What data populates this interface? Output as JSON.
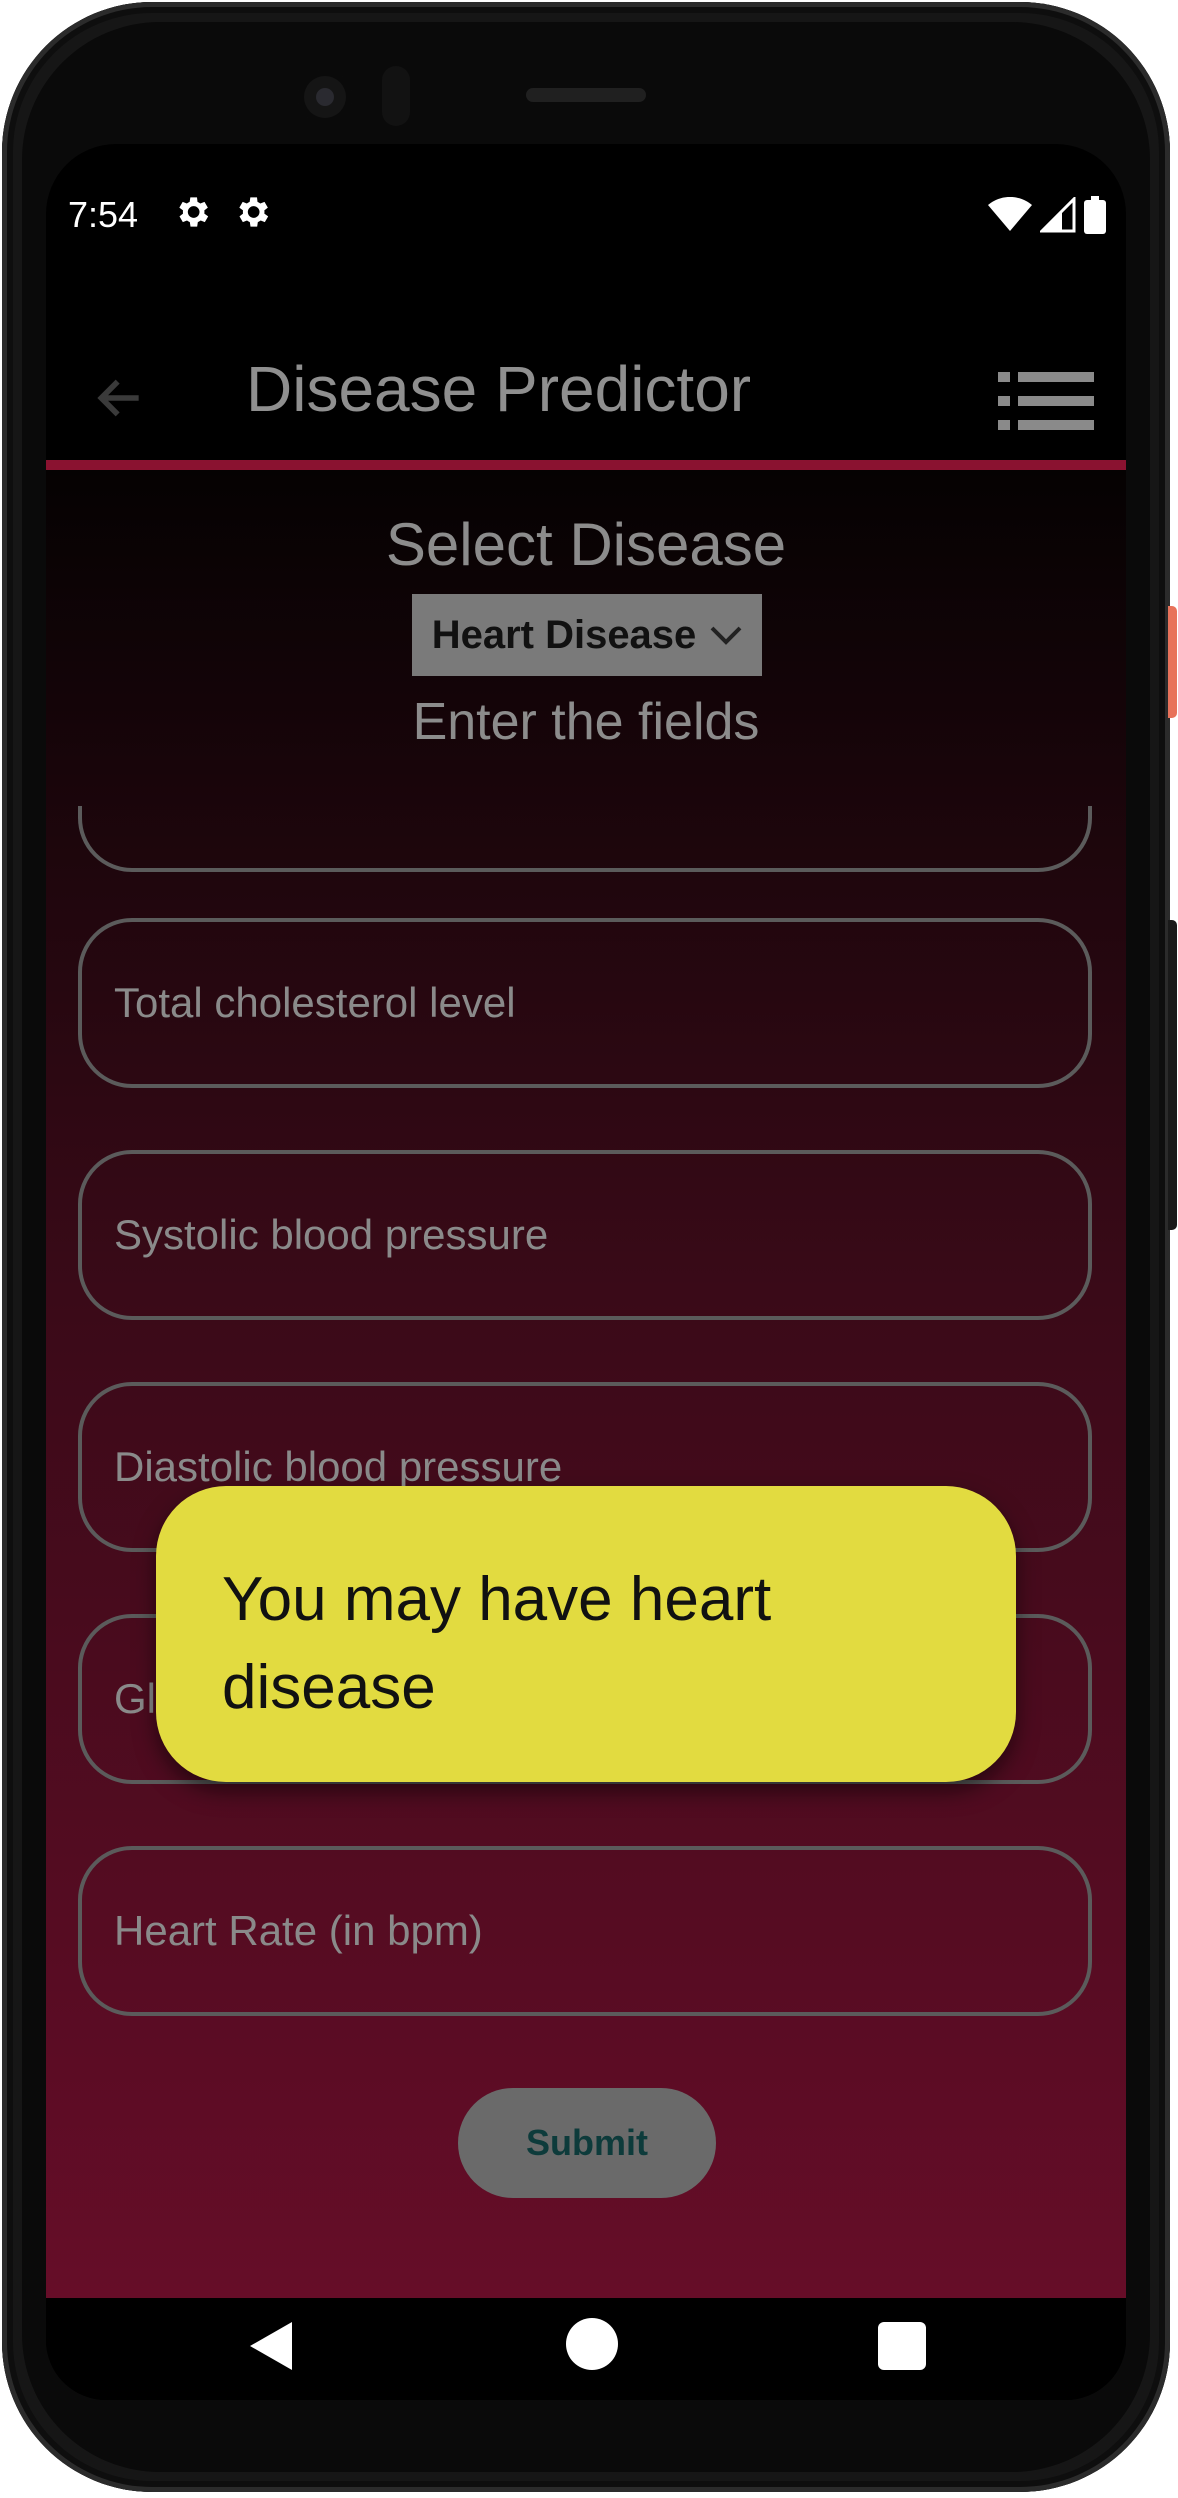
{
  "status_bar": {
    "time": "7:54",
    "left_icons": [
      "gear-icon",
      "gear-icon"
    ],
    "right_icons": [
      "wifi-icon",
      "signal-icon",
      "battery-icon"
    ]
  },
  "app_bar": {
    "title": "Disease Predictor",
    "back_icon": "arrow-left-icon",
    "menu_icon": "list-icon",
    "accent_color": "#8a1230"
  },
  "form": {
    "select_label": "Select Disease",
    "selected_disease": "Heart Disease",
    "instruction": "Enter the fields",
    "fields": [
      {
        "placeholder": "Total cholesterol level",
        "value": ""
      },
      {
        "placeholder": "Systolic blood pressure",
        "value": ""
      },
      {
        "placeholder": "Diastolic blood pressure",
        "value": ""
      },
      {
        "placeholder": "Glucose level",
        "value": ""
      },
      {
        "placeholder": "Heart Rate (in bpm)",
        "value": ""
      }
    ],
    "submit_label": "Submit"
  },
  "toast": {
    "message": "You may have heart disease",
    "background_color": "#e2db40"
  },
  "nav_bar": {
    "icons": [
      "back-triangle-icon",
      "home-circle-icon",
      "recents-square-icon"
    ]
  }
}
